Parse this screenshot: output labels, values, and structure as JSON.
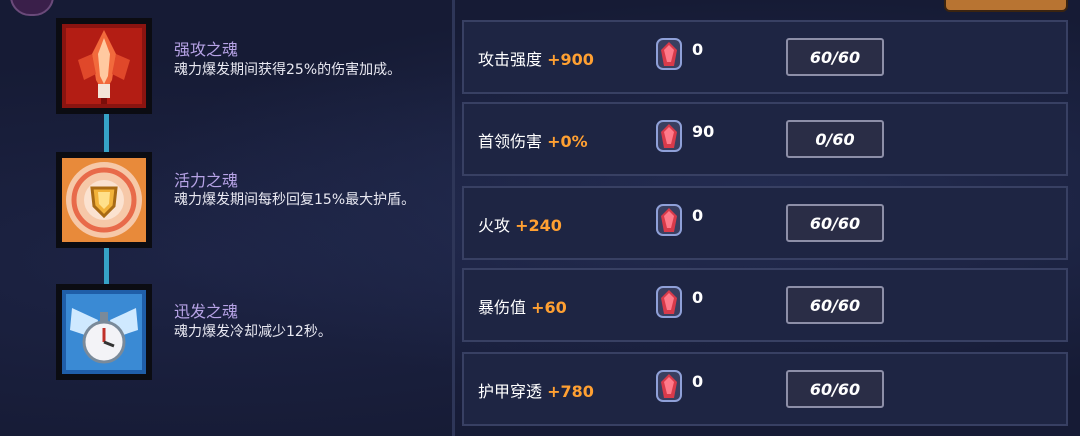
{
  "skills": [
    {
      "name": "强攻之魂",
      "desc": "魂力爆发期间获得25%的伤害加成。",
      "icon": "crimson-blade-icon"
    },
    {
      "name": "活力之魂",
      "desc": "魂力爆发期间每秒回复15%最大护盾。",
      "icon": "golden-shield-icon"
    },
    {
      "name": "迅发之魂",
      "desc": "魂力爆发冷却减少12秒。",
      "icon": "winged-clock-icon"
    }
  ],
  "stats": [
    {
      "label": "攻击强度",
      "bonus": "+900",
      "gems": "0",
      "progress": "60/60"
    },
    {
      "label": "首领伤害",
      "bonus": "+0%",
      "gems": "90",
      "progress": "0/60"
    },
    {
      "label": "火攻",
      "bonus": "+240",
      "gems": "0",
      "progress": "60/60"
    },
    {
      "label": "暴伤值",
      "bonus": "+60",
      "gems": "0",
      "progress": "60/60"
    },
    {
      "label": "护甲穿透",
      "bonus": "+780",
      "gems": "0",
      "progress": "60/60"
    }
  ],
  "colors": {
    "bonus": "#ffa032",
    "skill_name": "#b7a3e6",
    "connector": "#36a3c7",
    "gem": "#d83a4a"
  }
}
